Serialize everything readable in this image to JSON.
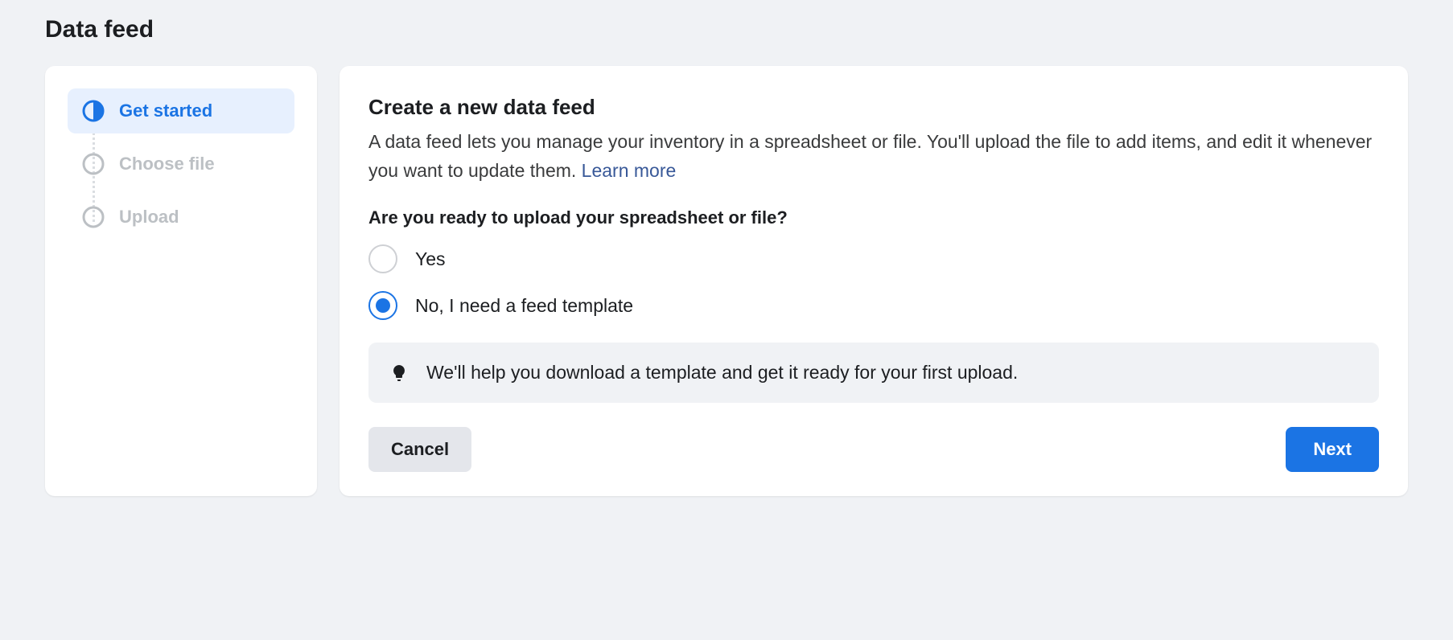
{
  "page": {
    "title": "Data feed"
  },
  "sidebar": {
    "steps": [
      {
        "label": "Get started",
        "state": "active"
      },
      {
        "label": "Choose file",
        "state": "inactive"
      },
      {
        "label": "Upload",
        "state": "inactive"
      }
    ]
  },
  "main": {
    "title": "Create a new data feed",
    "description": "A data feed lets you manage your inventory in a spreadsheet or file. You'll upload the file to add items, and edit it whenever you want to update them. ",
    "learnMore": "Learn more",
    "question": "Are you ready to upload your spreadsheet or file?",
    "options": {
      "yes": {
        "label": "Yes",
        "selected": false
      },
      "no": {
        "label": "No, I need a feed template",
        "selected": true
      }
    },
    "infoText": "We'll help you download a template and get it ready for your first upload.",
    "buttons": {
      "cancel": "Cancel",
      "next": "Next"
    }
  }
}
